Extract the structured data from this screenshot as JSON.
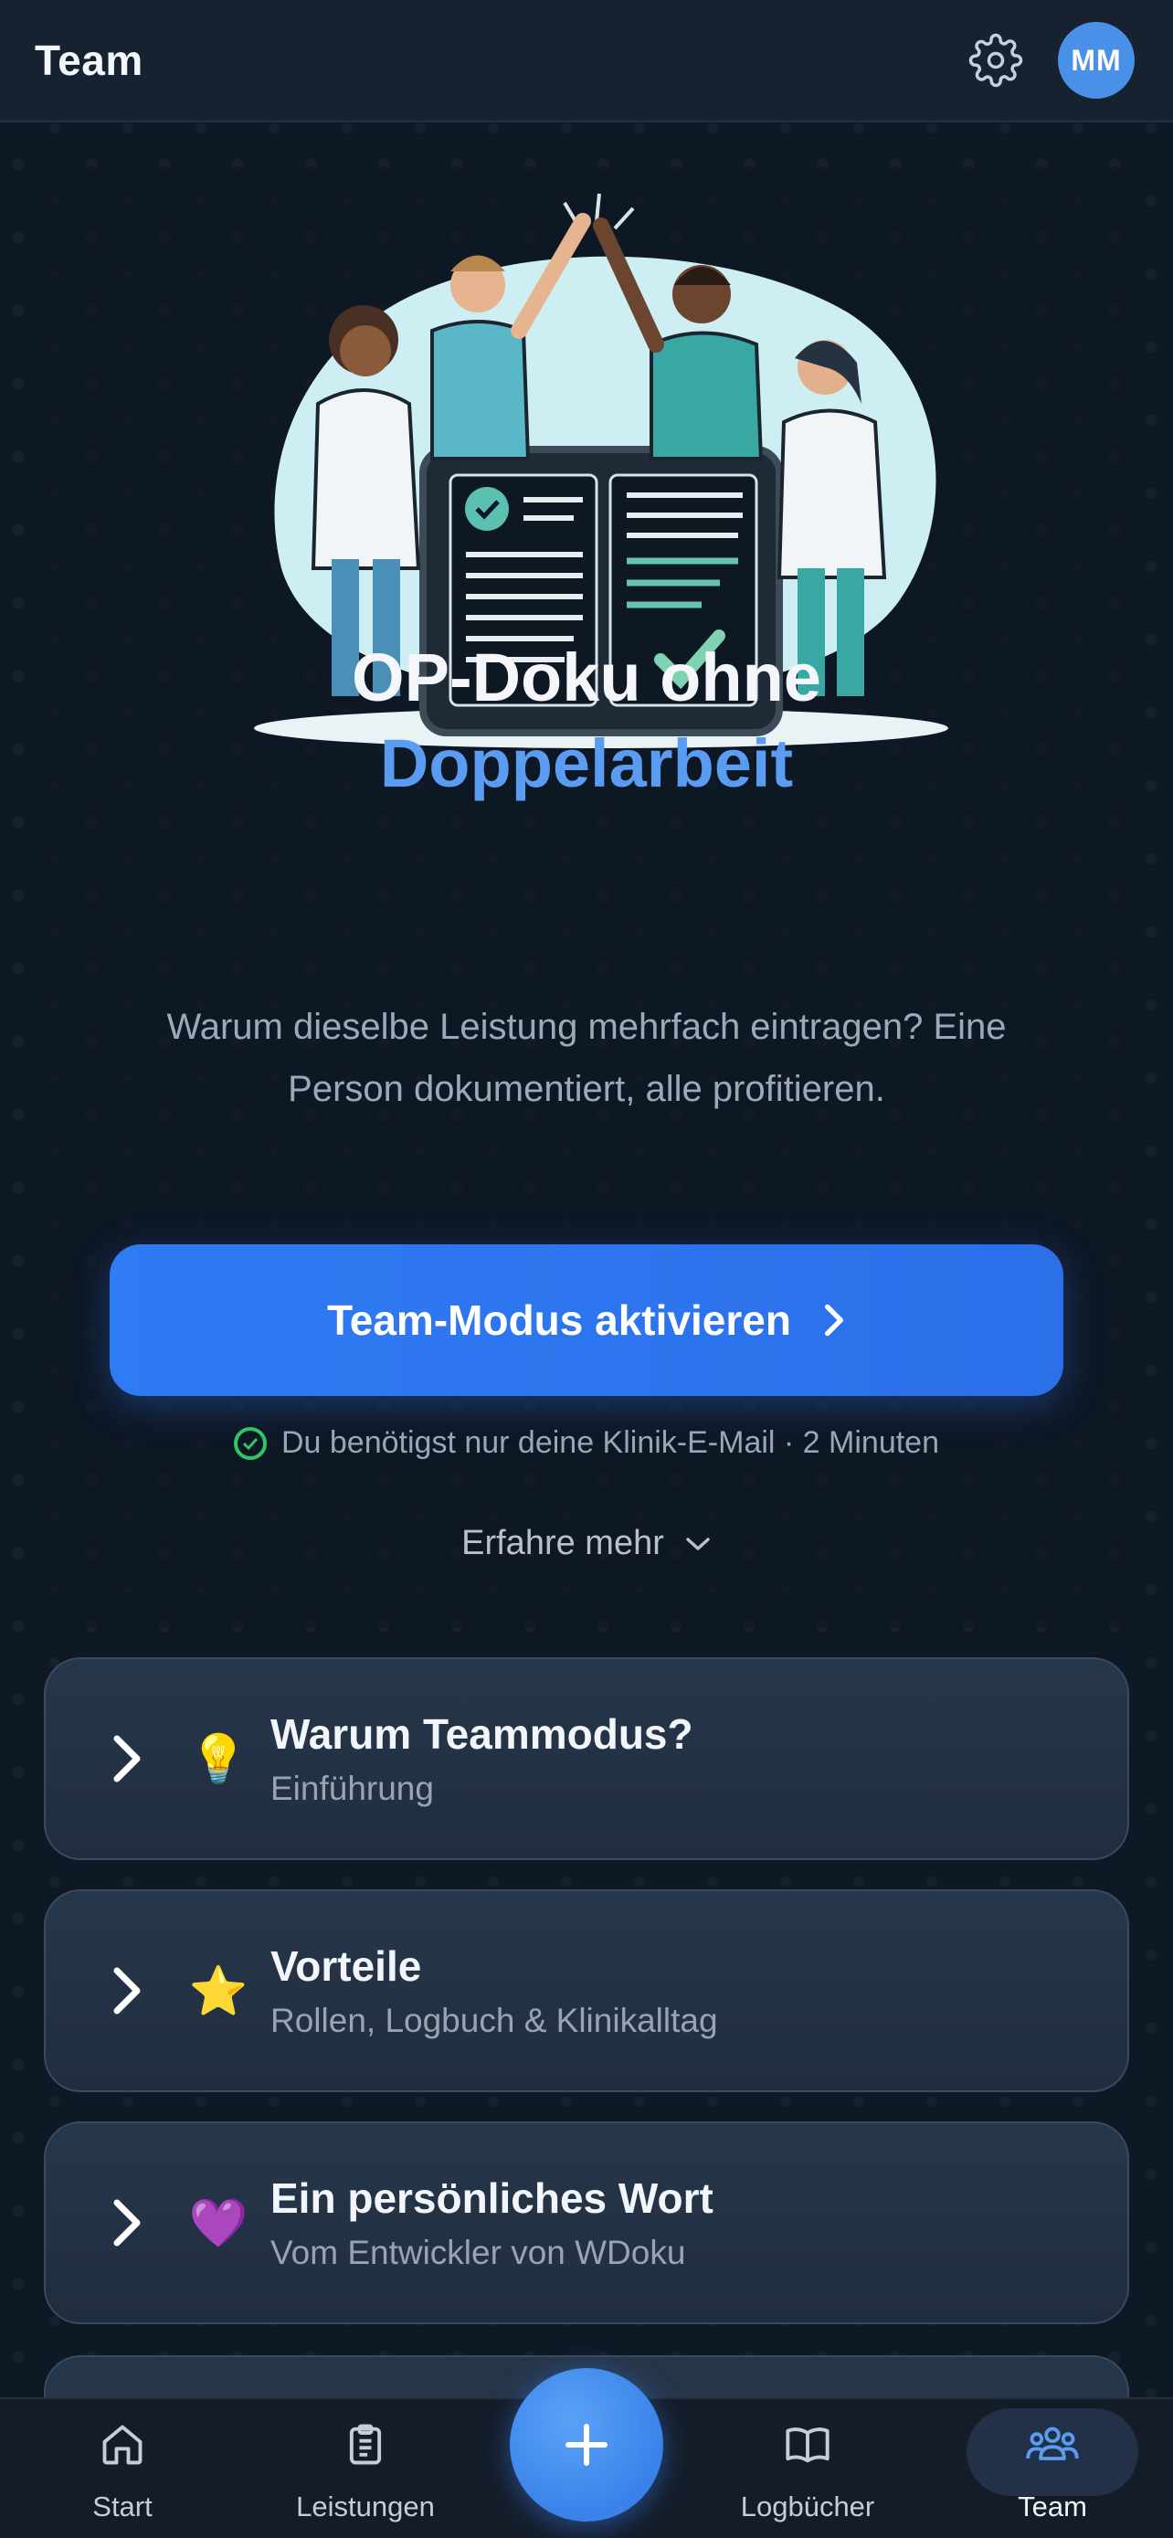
{
  "header": {
    "title": "Team",
    "avatar_initials": "MM"
  },
  "hero": {
    "title_line1": "OP-Doku ohne",
    "title_line2": "Doppelarbeit",
    "subtitle": "Warum dieselbe Leistung mehrfach eintragen? Eine Person dokumentiert, alle profitieren.",
    "cta_label": "Team-Modus aktivieren",
    "note": "Du benötigst nur deine Klinik-E-Mail · 2 Minuten",
    "more_label": "Erfahre mehr"
  },
  "sections": [
    {
      "emoji": "💡",
      "title": "Warum Teammodus?",
      "subtitle": "Einführung"
    },
    {
      "emoji": "⭐",
      "title": "Vorteile",
      "subtitle": "Rollen, Logbuch & Klinikalltag"
    },
    {
      "emoji": "💜",
      "title": "Ein persönliches Wort",
      "subtitle": "Vom Entwickler von WDoku"
    }
  ],
  "nav": {
    "items": [
      {
        "label": "Start",
        "icon": "home-icon"
      },
      {
        "label": "Leistungen",
        "icon": "clipboard-icon"
      },
      {
        "label": "Logbücher",
        "icon": "book-icon"
      },
      {
        "label": "Team",
        "icon": "team-icon",
        "active": true
      }
    ],
    "fab_icon": "plus-icon"
  },
  "colors": {
    "accent": "#5a9cf2",
    "cta": "#2f7bf3",
    "success": "#2fc765",
    "background": "#0f1926"
  }
}
